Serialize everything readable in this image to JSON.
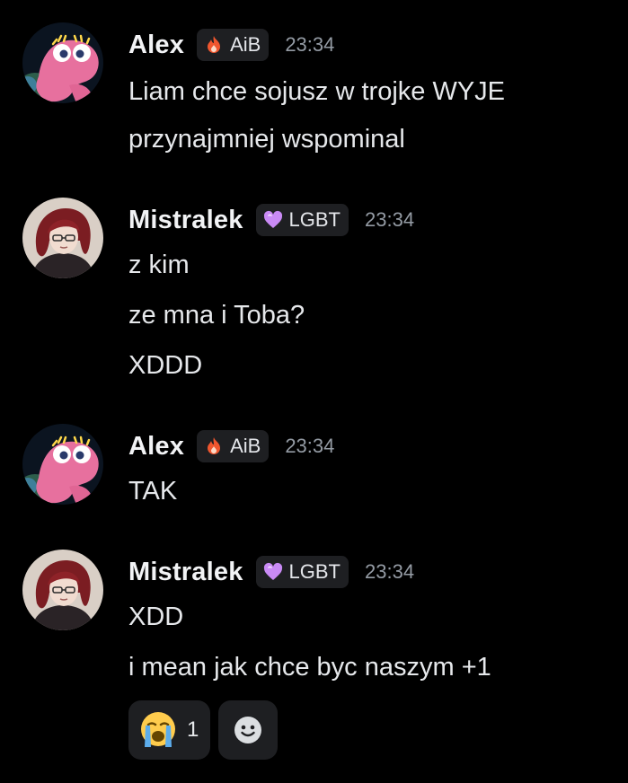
{
  "theme": {
    "background": "#000000",
    "pill_background": "#1e1f22",
    "username_color": "#f2f3f5",
    "timestamp_color": "#949ba4"
  },
  "messages": [
    {
      "author": "Alex",
      "tag": {
        "icon": "flame-icon",
        "label": "AiB"
      },
      "time": "23:34",
      "lines": [
        "Liam chce sojusz w trojke WYJE",
        "przynajmniej wspominal"
      ]
    },
    {
      "author": "Mistralek",
      "tag": {
        "icon": "heart-icon",
        "label": "LGBT"
      },
      "time": "23:34",
      "lines": [
        "z kim",
        "ze mna i Toba?",
        "XDDD"
      ]
    },
    {
      "author": "Alex",
      "tag": {
        "icon": "flame-icon",
        "label": "AiB"
      },
      "time": "23:34",
      "lines": [
        "TAK"
      ]
    },
    {
      "author": "Mistralek",
      "tag": {
        "icon": "heart-icon",
        "label": "LGBT"
      },
      "time": "23:34",
      "lines": [
        "XDD",
        "i mean jak chce byc naszym +1"
      ]
    }
  ],
  "reactions": [
    {
      "emoji": "loudly-crying-face-icon",
      "count": "1"
    }
  ],
  "add_reaction_icon": "smiley-add-reaction-icon"
}
